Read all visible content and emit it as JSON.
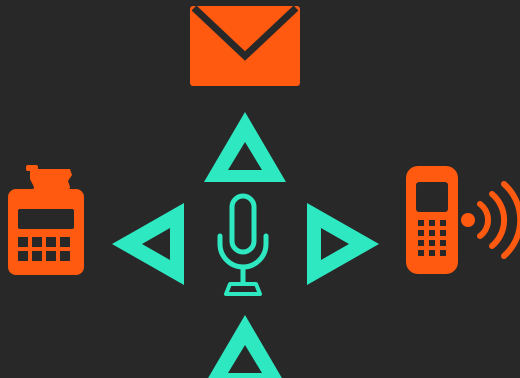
{
  "colors": {
    "background": "#282828",
    "device_color": "#ff5a0f",
    "arrow_color": "#2ee8c1"
  },
  "icons": {
    "top": "mail-icon",
    "left": "cash-register-icon",
    "right": "mobile-phone-signal-icon",
    "center": "microphone-icon",
    "arrows": [
      "arrow-up-icon",
      "arrow-down-icon",
      "arrow-left-icon",
      "arrow-right-icon"
    ]
  }
}
